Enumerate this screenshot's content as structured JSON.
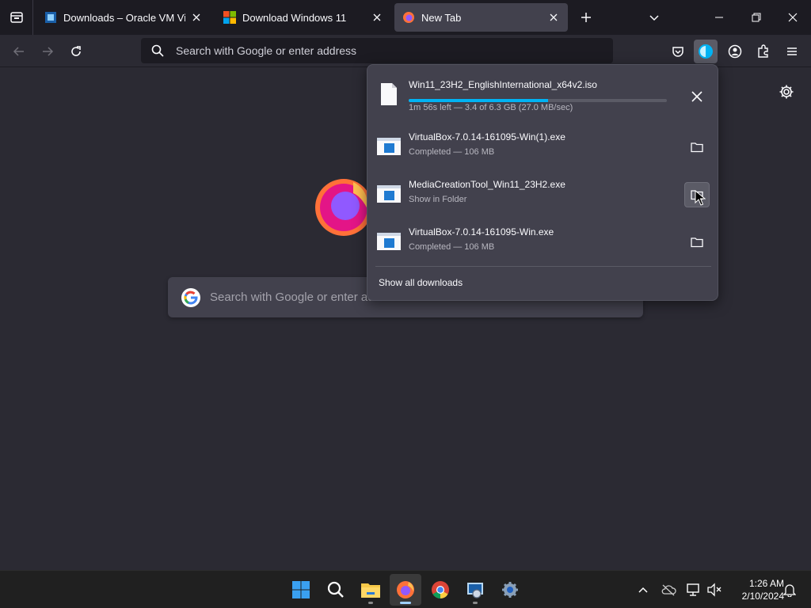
{
  "tabs": [
    {
      "title": "Downloads – Oracle VM VirtualBox",
      "favicon": "virtualbox-icon",
      "active": false
    },
    {
      "title": "Download Windows 11",
      "favicon": "microsoft-icon",
      "active": false
    },
    {
      "title": "New Tab",
      "favicon": "firefox-icon",
      "active": true
    }
  ],
  "urlbar": {
    "placeholder": "Search with Google or enter address"
  },
  "content": {
    "search_placeholder": "Search with Google or enter address"
  },
  "downloads": {
    "items": [
      {
        "name": "Win11_23H2_EnglishInternational_x64v2.iso",
        "status": "1m 56s left — 3.4 of 6.3 GB (27.0 MB/sec)",
        "progress": 0.54,
        "icon": "file-icon",
        "action": "cancel-icon"
      },
      {
        "name": "VirtualBox-7.0.14-161095-Win(1).exe",
        "status": "Completed — 106 MB",
        "icon": "exe-icon",
        "action": "folder-icon"
      },
      {
        "name": "MediaCreationTool_Win11_23H2.exe",
        "status": "Show in Folder",
        "icon": "exe-icon",
        "action": "folder-icon"
      },
      {
        "name": "VirtualBox-7.0.14-161095-Win.exe",
        "status": "Completed — 106 MB",
        "icon": "exe-icon",
        "action": "folder-icon"
      }
    ],
    "show_all": "Show all downloads"
  },
  "taskbar": {
    "apps": [
      "start-icon",
      "search-icon",
      "file-explorer-icon",
      "firefox-icon",
      "chrome-icon",
      "virtualbox-icon",
      "settings-icon"
    ],
    "time": "1:26 AM",
    "date": "2/10/2024"
  },
  "colors": {
    "accent": "#00b3f4",
    "panel": "#42414d",
    "background": "#2b2a33"
  }
}
